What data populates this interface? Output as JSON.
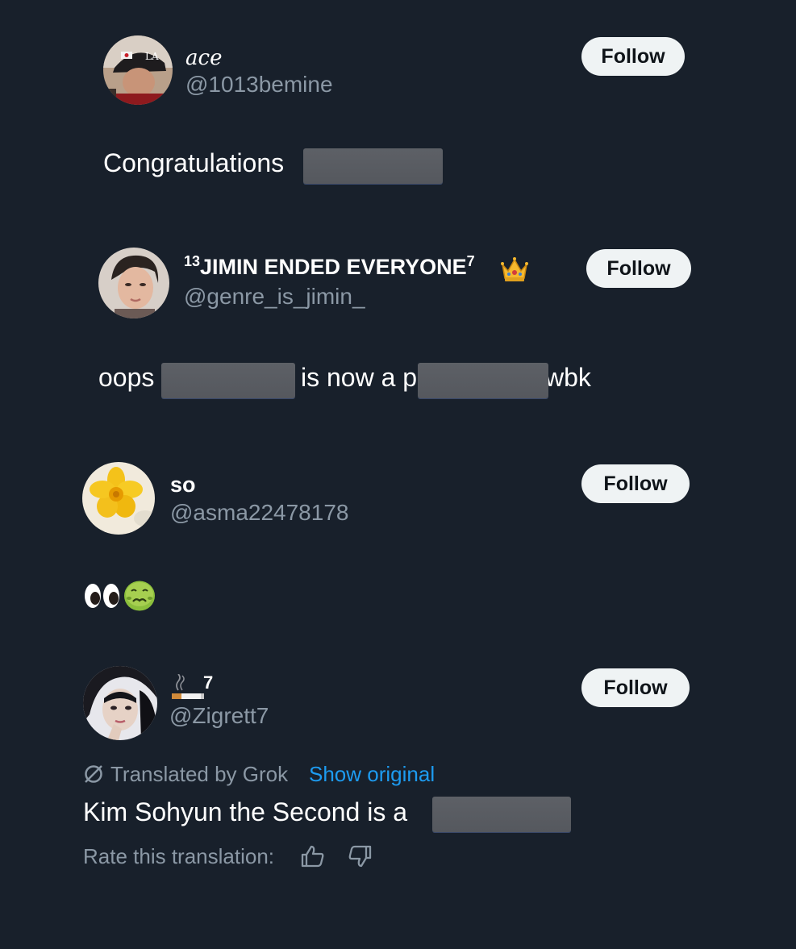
{
  "accent_color": "#1d9bf0",
  "background_color": "#18202b",
  "replies": [
    {
      "display_name": "ace",
      "handle": "@1013bemine",
      "follow_label": "Follow",
      "text_parts": [
        "Congratulations"
      ]
    },
    {
      "display_name_prefix": "13",
      "display_name": "JIMIN ENDED EVERYONE",
      "display_name_suffix": "7",
      "display_name_emoji": "crown",
      "handle": "@genre_is_jimin_",
      "follow_label": "Follow",
      "text_parts": [
        "oops",
        "is now a p",
        "wbk"
      ]
    },
    {
      "display_name": "so",
      "handle": "@asma22478178",
      "follow_label": "Follow",
      "text_parts": [],
      "emojis": [
        "eyes",
        "nauseated-face"
      ]
    },
    {
      "display_name_emoji": "cigarette",
      "display_name": "7",
      "handle": "@Zigrett7",
      "follow_label": "Follow",
      "translated_by": "Translated by Grok",
      "show_original": "Show original",
      "text_parts": [
        "Kim Sohyun the Second is a"
      ],
      "rate_label": "Rate this translation:",
      "rate_icons": [
        "thumbs-up-icon",
        "thumbs-down-icon"
      ]
    }
  ]
}
